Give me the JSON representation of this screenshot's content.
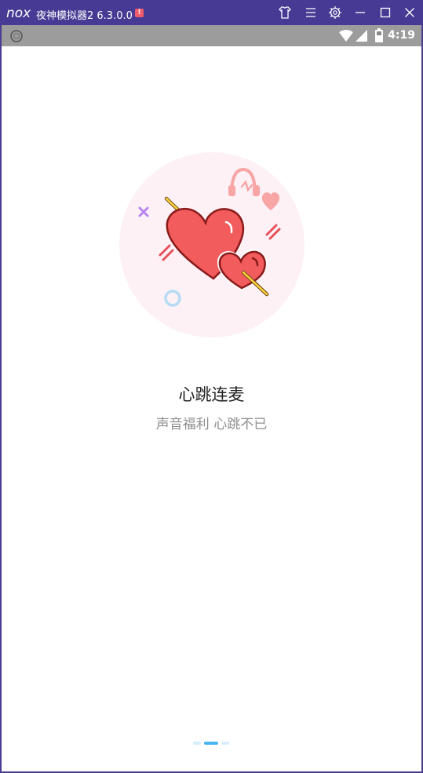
{
  "window": {
    "logo": "nox",
    "title": "夜神模拟器2 6.3.0.0",
    "alert_icon_text": "!",
    "controls": [
      "shirt-icon",
      "menu-icon",
      "gear-icon",
      "minimize-icon",
      "maximize-icon",
      "close-icon"
    ]
  },
  "statusbar": {
    "time": "4:19",
    "icons": [
      "nox-assist-icon",
      "wifi-icon",
      "signal-icon",
      "battery-icon"
    ]
  },
  "intro": {
    "title": "心跳连麦",
    "subtitle": "声音福利 心跳不已",
    "page_count": 3,
    "current_page": 2
  },
  "colors": {
    "titlebar": "#473a94",
    "statusbar": "#9c9c9c",
    "heart": "#f25c5c",
    "pager_active": "#46b5f0"
  }
}
